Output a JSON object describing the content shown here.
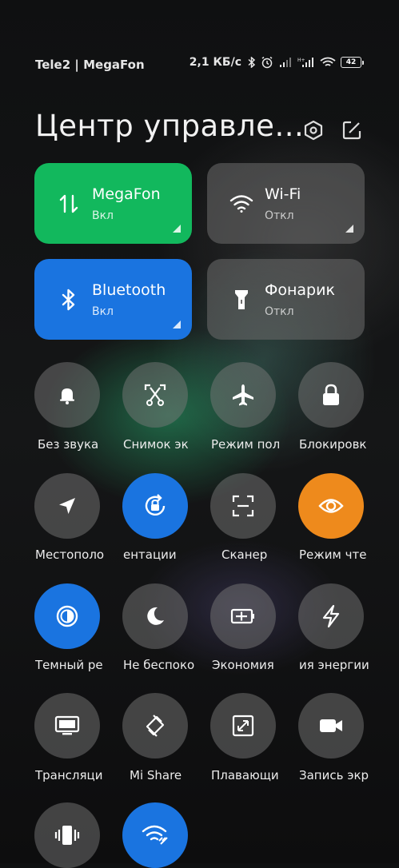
{
  "status": {
    "carrier": "Tele2  | MegaFon",
    "speed": "2,1 КБ/с",
    "battery": "42"
  },
  "header": {
    "title": "Центр управле..."
  },
  "tiles": [
    {
      "name": "MegaFon",
      "state": "Вкл",
      "color": "#12b85d",
      "icon": "mobile-data-icon"
    },
    {
      "name": "Wi-Fi",
      "state": "Откл",
      "color": "#6e6e6e",
      "icon": "wifi-icon"
    },
    {
      "name": "Bluetooth",
      "state": "Вкл",
      "color": "#1a74e0",
      "icon": "bluetooth-icon"
    },
    {
      "name": "Фонарик",
      "state": "Откл",
      "color": "#6e6e6e",
      "icon": "flashlight-icon"
    }
  ],
  "toggles": [
    {
      "label": "Без звука",
      "icon": "bell-icon",
      "active": false
    },
    {
      "label": "Снимок эк",
      "icon": "screenshot-icon",
      "active": false
    },
    {
      "label": "Режим пол",
      "icon": "airplane-icon",
      "active": false
    },
    {
      "label": "Блокировк",
      "icon": "lock-icon",
      "active": false
    },
    {
      "label": "Местополо",
      "icon": "location-icon",
      "active": false
    },
    {
      "label": "ентации",
      "icon": "rotation-lock-icon",
      "active": true
    },
    {
      "label": "Сканер",
      "icon": "scanner-icon",
      "active": false
    },
    {
      "label": "Режим чте",
      "icon": "eye-icon",
      "active": true
    },
    {
      "label": "Темный ре",
      "icon": "dark-mode-icon",
      "active": true
    },
    {
      "label": "Не беспоко",
      "icon": "moon-icon",
      "active": false
    },
    {
      "label": "Экономия",
      "icon": "battery-saver-icon",
      "active": false
    },
    {
      "label": "ия энергии",
      "icon": "lightning-icon",
      "active": false
    },
    {
      "label": "Трансляци",
      "icon": "cast-icon",
      "active": false
    },
    {
      "label": "Mi Share",
      "icon": "mi-share-icon",
      "active": false
    },
    {
      "label": "Плавающи",
      "icon": "floating-window-icon",
      "active": false
    },
    {
      "label": "Запись экр",
      "icon": "screen-record-icon",
      "active": false
    },
    {
      "label": "",
      "icon": "vibrate-icon",
      "active": false
    },
    {
      "label": "",
      "icon": "wifi-share-icon",
      "active": true
    }
  ]
}
